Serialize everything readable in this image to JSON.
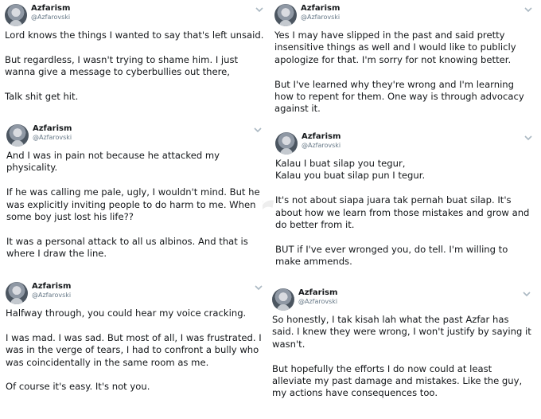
{
  "tweets": [
    {
      "name": "Azfarism",
      "handle": "@Azfarovski",
      "paragraphs": [
        "Lord knows the things I wanted to say that's left unsaid.",
        "But regardless, I wasn't trying to shame him. I just wanna give a message to cyberbullies out there,",
        "Talk shit get hit."
      ]
    },
    {
      "name": "Azfarism",
      "handle": "@Azfarovski",
      "paragraphs": [
        "Yes I may have slipped in the past and said pretty insensitive things as well and I would like to publicly apologize for that. I'm sorry for not knowing better.",
        "But I've learned why they're wrong and I'm learning how to repent for them. One way is through advocacy against it."
      ]
    },
    {
      "name": "Azfarism",
      "handle": "@Azfarovski",
      "paragraphs": [
        "And I was in pain not because he attacked my physicality.",
        "If he was calling me pale, ugly, I wouldn't mind. But he was explicitly inviting people to do harm to me. When some boy just lost his life??",
        "It was a personal attack to all us albinos. And that is where I draw the line."
      ]
    },
    {
      "name": "Azfarism",
      "handle": "@Azfarovski",
      "paragraphs": [
        "Kalau I buat silap you tegur,\nKalau you buat silap pun I tegur.",
        "It's not about siapa juara tak pernah buat silap. It's about how we learn from those mistakes and grow and do better from it.",
        "BUT if I've ever wronged you, do tell. I'm willing to make ammends."
      ]
    },
    {
      "name": "Azfarism",
      "handle": "@Azfarovski",
      "paragraphs": [
        "Halfway through, you could hear my voice cracking.",
        "I was mad. I was sad. But most of all, I was frustrated. I was in the verge of tears, I had to confront a bully who was coincidentally in the same room as me.",
        "Of course it's easy. It's not you."
      ]
    },
    {
      "name": "Azfarism",
      "handle": "@Azfarovski",
      "paragraphs": [
        "So honestly, I tak kisah lah what the past Azfar has said. I knew they were wrong, I won't justify by saying it wasn't.",
        "But hopefully the efforts I do now could at least alleviate my past damage and mistakes. Like the guy, my actions have consequences too."
      ]
    }
  ],
  "watermark": "Star",
  "colors": {
    "text": "#14171a",
    "handle": "#657786",
    "chevron": "#aab8c2"
  }
}
